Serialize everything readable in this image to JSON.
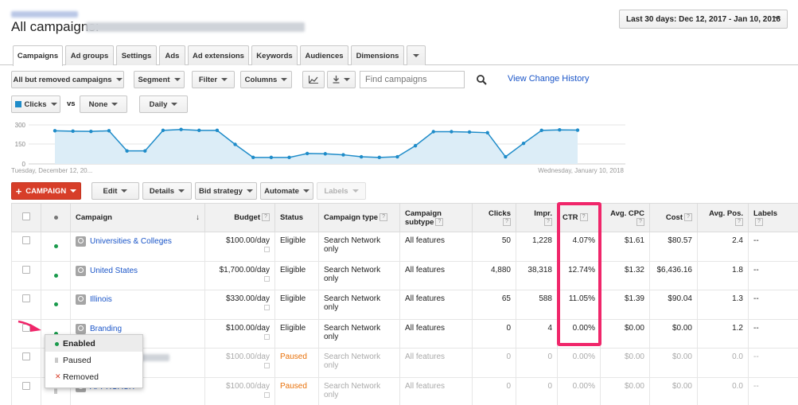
{
  "header": {
    "title": "All campaigns:",
    "date_range": "Last 30 days: Dec 12, 2017 - Jan 10, 2018"
  },
  "tabs": [
    {
      "label": "Campaigns",
      "active": true
    },
    {
      "label": "Ad groups"
    },
    {
      "label": "Settings"
    },
    {
      "label": "Ads"
    },
    {
      "label": "Ad extensions"
    },
    {
      "label": "Keywords"
    },
    {
      "label": "Audiences"
    },
    {
      "label": "Dimensions"
    }
  ],
  "toolbar": {
    "filter_view": "All but removed campaigns",
    "segment": "Segment",
    "filter": "Filter",
    "columns": "Columns",
    "search_placeholder": "Find campaigns",
    "view_history": "View Change History"
  },
  "chart_controls": {
    "metric1": "Clicks",
    "vs": "vs",
    "metric2": "None",
    "period": "Daily"
  },
  "chart_data": {
    "type": "line",
    "x_start_label": "Tuesday, December 12, 20...",
    "x_end_label": "Wednesday, January 10, 2018",
    "y_ticks": [
      "300",
      "150",
      "0"
    ],
    "ylim": [
      0,
      300
    ],
    "values": [
      255,
      252,
      250,
      255,
      100,
      100,
      258,
      265,
      258,
      258,
      150,
      50,
      50,
      50,
      80,
      78,
      70,
      55,
      50,
      55,
      140,
      248,
      248,
      245,
      240,
      55,
      158,
      258,
      262,
      260
    ],
    "color": "#1f8cc9"
  },
  "actions": {
    "new_campaign": "CAMPAIGN",
    "edit": "Edit",
    "details": "Details",
    "bid_strategy": "Bid strategy",
    "automate": "Automate",
    "labels": "Labels"
  },
  "table": {
    "headers": {
      "campaign": "Campaign",
      "budget": "Budget",
      "status": "Status",
      "campaign_type": "Campaign type",
      "campaign_subtype": "Campaign subtype",
      "clicks": "Clicks",
      "impr": "Impr.",
      "ctr": "CTR",
      "avg_cpc": "Avg. CPC",
      "cost": "Cost",
      "avg_pos": "Avg. Pos.",
      "labels": "Labels"
    },
    "rows": [
      {
        "name": "Universities & Colleges",
        "budget": "$100.00/day",
        "status": "Eligible",
        "type": "Search Network only",
        "subtype": "All features",
        "clicks": "50",
        "impr": "1,228",
        "ctr": "4.07%",
        "cpc": "$1.61",
        "cost": "$80.57",
        "pos": "2.4",
        "labels": "--"
      },
      {
        "name": "United States",
        "budget": "$1,700.00/day",
        "status": "Eligible",
        "type": "Search Network only",
        "subtype": "All features",
        "clicks": "4,880",
        "impr": "38,318",
        "ctr": "12.74%",
        "cpc": "$1.32",
        "cost": "$6,436.16",
        "pos": "1.8",
        "labels": "--"
      },
      {
        "name": "Illinois",
        "budget": "$330.00/day",
        "status": "Eligible",
        "type": "Search Network only",
        "subtype": "All features",
        "clicks": "65",
        "impr": "588",
        "ctr": "11.05%",
        "cpc": "$1.39",
        "cost": "$90.04",
        "pos": "1.3",
        "labels": "--"
      },
      {
        "name": "Branding",
        "budget": "$100.00/day",
        "status": "Eligible",
        "type": "Search Network only",
        "subtype": "All features",
        "clicks": "0",
        "impr": "4",
        "ctr": "0.00%",
        "cpc": "$0.00",
        "cost": "$0.00",
        "pos": "1.2",
        "labels": "--"
      },
      {
        "name": "",
        "budget": "$100.00/day",
        "status": "Paused",
        "type": "Search Network only",
        "subtype": "All features",
        "clicks": "0",
        "impr": "0",
        "ctr": "0.00%",
        "cpc": "$0.00",
        "cost": "$0.00",
        "pos": "0.0",
        "labels": "--"
      },
      {
        "name": "APPROACH",
        "budget": "$100.00/day",
        "status": "Paused",
        "type": "Search Network only",
        "subtype": "All features",
        "clicks": "0",
        "impr": "0",
        "ctr": "0.00%",
        "cpc": "$0.00",
        "cost": "$0.00",
        "pos": "0.0",
        "labels": "--"
      }
    ]
  },
  "status_menu": {
    "enabled": "Enabled",
    "paused": "Paused",
    "removed": "Removed"
  },
  "colors": {
    "accent_link": "#1a55c8",
    "new_campaign_red": "#d73e29",
    "highlight_pink": "#f0266a",
    "enabled_green": "#1a9a4c",
    "paused_orange": "#e8710a"
  }
}
